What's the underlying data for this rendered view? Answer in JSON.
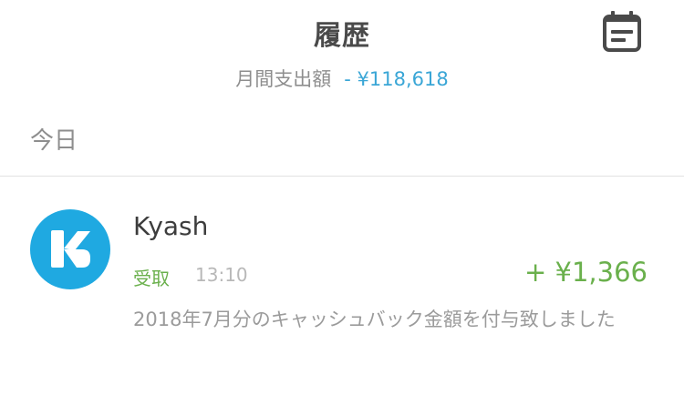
{
  "header": {
    "title": "履歴",
    "calendar_icon": "calendar-icon",
    "monthly_label": "月間支出額",
    "monthly_value": "- ¥118,618"
  },
  "section": {
    "label": "今日"
  },
  "transactions": [
    {
      "merchant": "Kyash",
      "avatar_icon": "kyash-logo-icon",
      "type": "受取",
      "time": "13:10",
      "amount": "+ ¥1,366",
      "description": "2018年7月分のキャッシュバック金額を付与致しました"
    }
  ],
  "colors": {
    "accent_blue": "#3aa6d6",
    "avatar_blue": "#1fa9e1",
    "income_green": "#6ab04c",
    "title_gray": "#4a4a4a",
    "label_gray": "#8e8e8e"
  }
}
